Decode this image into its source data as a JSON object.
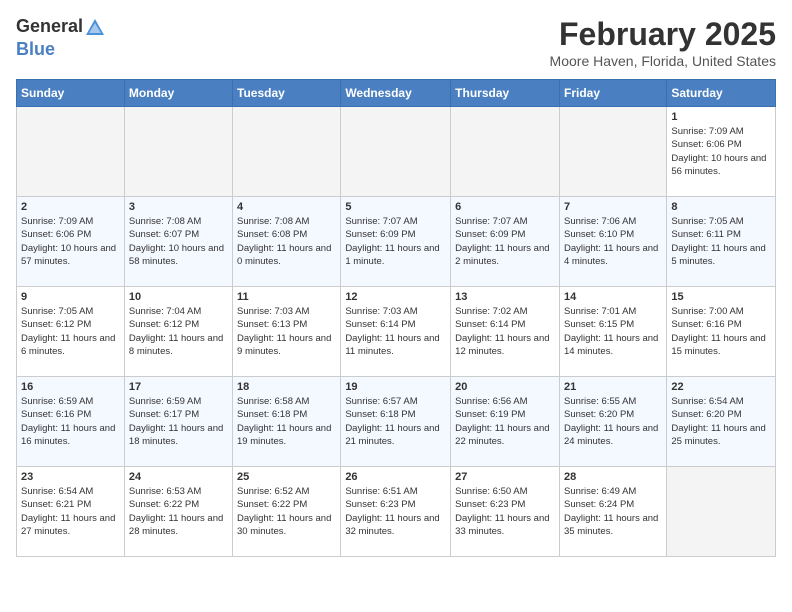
{
  "header": {
    "logo_general": "General",
    "logo_blue": "Blue",
    "month_year": "February 2025",
    "location": "Moore Haven, Florida, United States"
  },
  "days_of_week": [
    "Sunday",
    "Monday",
    "Tuesday",
    "Wednesday",
    "Thursday",
    "Friday",
    "Saturday"
  ],
  "weeks": [
    [
      {
        "day": "",
        "info": "",
        "empty": true
      },
      {
        "day": "",
        "info": "",
        "empty": true
      },
      {
        "day": "",
        "info": "",
        "empty": true
      },
      {
        "day": "",
        "info": "",
        "empty": true
      },
      {
        "day": "",
        "info": "",
        "empty": true
      },
      {
        "day": "",
        "info": "",
        "empty": true
      },
      {
        "day": "1",
        "info": "Sunrise: 7:09 AM\nSunset: 6:06 PM\nDaylight: 10 hours and 56 minutes.",
        "empty": false
      }
    ],
    [
      {
        "day": "2",
        "info": "Sunrise: 7:09 AM\nSunset: 6:06 PM\nDaylight: 10 hours and 57 minutes.",
        "empty": false
      },
      {
        "day": "3",
        "info": "Sunrise: 7:08 AM\nSunset: 6:07 PM\nDaylight: 10 hours and 58 minutes.",
        "empty": false
      },
      {
        "day": "4",
        "info": "Sunrise: 7:08 AM\nSunset: 6:08 PM\nDaylight: 11 hours and 0 minutes.",
        "empty": false
      },
      {
        "day": "5",
        "info": "Sunrise: 7:07 AM\nSunset: 6:09 PM\nDaylight: 11 hours and 1 minute.",
        "empty": false
      },
      {
        "day": "6",
        "info": "Sunrise: 7:07 AM\nSunset: 6:09 PM\nDaylight: 11 hours and 2 minutes.",
        "empty": false
      },
      {
        "day": "7",
        "info": "Sunrise: 7:06 AM\nSunset: 6:10 PM\nDaylight: 11 hours and 4 minutes.",
        "empty": false
      },
      {
        "day": "8",
        "info": "Sunrise: 7:05 AM\nSunset: 6:11 PM\nDaylight: 11 hours and 5 minutes.",
        "empty": false
      }
    ],
    [
      {
        "day": "9",
        "info": "Sunrise: 7:05 AM\nSunset: 6:12 PM\nDaylight: 11 hours and 6 minutes.",
        "empty": false
      },
      {
        "day": "10",
        "info": "Sunrise: 7:04 AM\nSunset: 6:12 PM\nDaylight: 11 hours and 8 minutes.",
        "empty": false
      },
      {
        "day": "11",
        "info": "Sunrise: 7:03 AM\nSunset: 6:13 PM\nDaylight: 11 hours and 9 minutes.",
        "empty": false
      },
      {
        "day": "12",
        "info": "Sunrise: 7:03 AM\nSunset: 6:14 PM\nDaylight: 11 hours and 11 minutes.",
        "empty": false
      },
      {
        "day": "13",
        "info": "Sunrise: 7:02 AM\nSunset: 6:14 PM\nDaylight: 11 hours and 12 minutes.",
        "empty": false
      },
      {
        "day": "14",
        "info": "Sunrise: 7:01 AM\nSunset: 6:15 PM\nDaylight: 11 hours and 14 minutes.",
        "empty": false
      },
      {
        "day": "15",
        "info": "Sunrise: 7:00 AM\nSunset: 6:16 PM\nDaylight: 11 hours and 15 minutes.",
        "empty": false
      }
    ],
    [
      {
        "day": "16",
        "info": "Sunrise: 6:59 AM\nSunset: 6:16 PM\nDaylight: 11 hours and 16 minutes.",
        "empty": false
      },
      {
        "day": "17",
        "info": "Sunrise: 6:59 AM\nSunset: 6:17 PM\nDaylight: 11 hours and 18 minutes.",
        "empty": false
      },
      {
        "day": "18",
        "info": "Sunrise: 6:58 AM\nSunset: 6:18 PM\nDaylight: 11 hours and 19 minutes.",
        "empty": false
      },
      {
        "day": "19",
        "info": "Sunrise: 6:57 AM\nSunset: 6:18 PM\nDaylight: 11 hours and 21 minutes.",
        "empty": false
      },
      {
        "day": "20",
        "info": "Sunrise: 6:56 AM\nSunset: 6:19 PM\nDaylight: 11 hours and 22 minutes.",
        "empty": false
      },
      {
        "day": "21",
        "info": "Sunrise: 6:55 AM\nSunset: 6:20 PM\nDaylight: 11 hours and 24 minutes.",
        "empty": false
      },
      {
        "day": "22",
        "info": "Sunrise: 6:54 AM\nSunset: 6:20 PM\nDaylight: 11 hours and 25 minutes.",
        "empty": false
      }
    ],
    [
      {
        "day": "23",
        "info": "Sunrise: 6:54 AM\nSunset: 6:21 PM\nDaylight: 11 hours and 27 minutes.",
        "empty": false
      },
      {
        "day": "24",
        "info": "Sunrise: 6:53 AM\nSunset: 6:22 PM\nDaylight: 11 hours and 28 minutes.",
        "empty": false
      },
      {
        "day": "25",
        "info": "Sunrise: 6:52 AM\nSunset: 6:22 PM\nDaylight: 11 hours and 30 minutes.",
        "empty": false
      },
      {
        "day": "26",
        "info": "Sunrise: 6:51 AM\nSunset: 6:23 PM\nDaylight: 11 hours and 32 minutes.",
        "empty": false
      },
      {
        "day": "27",
        "info": "Sunrise: 6:50 AM\nSunset: 6:23 PM\nDaylight: 11 hours and 33 minutes.",
        "empty": false
      },
      {
        "day": "28",
        "info": "Sunrise: 6:49 AM\nSunset: 6:24 PM\nDaylight: 11 hours and 35 minutes.",
        "empty": false
      },
      {
        "day": "",
        "info": "",
        "empty": true
      }
    ]
  ]
}
